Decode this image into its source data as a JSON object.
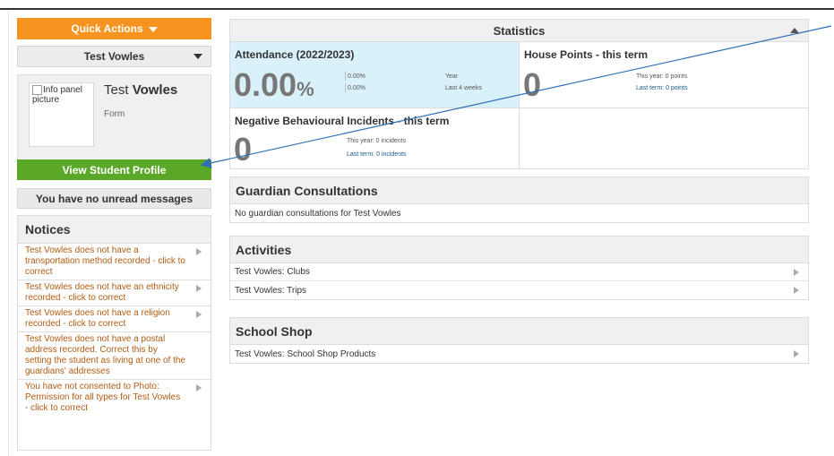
{
  "sidebar": {
    "quick_actions": "Quick Actions",
    "student_select": "Test Vowles",
    "info_panel": {
      "picture_alt": "Info panel picture",
      "first_name": "Test",
      "last_name": "Vowles",
      "form_label": "Form"
    },
    "view_profile": "View Student Profile",
    "unread_messages": "You have no unread messages",
    "notices": {
      "title": "Notices",
      "items": [
        "Test Vowles does not have a transportation method recorded - click to correct",
        "Test Vowles does not have an ethnicity recorded - click to correct",
        "Test Vowles does not have a religion recorded - click to correct",
        "Test Vowles does not have a postal address recorded. Correct this by setting the student as living at one of the guardians' addresses",
        "You have not consented to Photo: Permission for all types for Test Vowles - click to correct"
      ]
    }
  },
  "statistics": {
    "title": "Statistics",
    "attendance": {
      "title": "Attendance (2022/2023)",
      "big_value": "0.00",
      "big_unit": "%",
      "year_value": "0.00%",
      "year_label": "Year",
      "recent_value": "0.00%",
      "recent_label": "Last 4 weeks"
    },
    "house_points": {
      "title": "House Points - this term",
      "big_value": "0",
      "this_year": "This year: 0 points",
      "last_term": "Last term: 0 points"
    },
    "negative": {
      "title": "Negative Behavioural Incidents - this term",
      "big_value": "0",
      "this_year": "This year: 0 incidents",
      "last_term": "Last term: 0 incidents"
    }
  },
  "guardian": {
    "title": "Guardian Consultations",
    "text": "No guardian consultations for Test Vowles"
  },
  "activities": {
    "title": "Activities",
    "items": [
      "Test Vowles: Clubs",
      "Test Vowles: Trips"
    ]
  },
  "shop": {
    "title": "School Shop",
    "items": [
      "Test Vowles: School Shop Products"
    ]
  },
  "colors": {
    "orange": "#f79420",
    "green": "#5ba829",
    "attendance_bg": "#d9f1fa",
    "notice_text": "#b05c14",
    "annotation_line": "#2f6fb3"
  }
}
